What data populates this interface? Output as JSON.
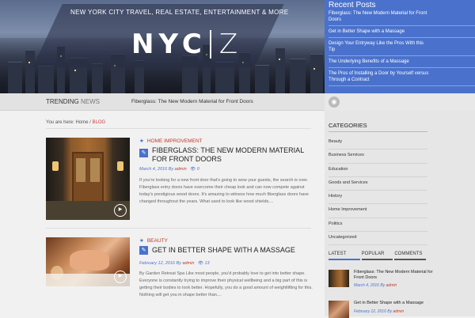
{
  "header": {
    "tagline": "NEW YORK CITY TRAVEL, REAL ESTATE, ENTERTAINMENT & MORE",
    "logo_left": "NYC",
    "logo_right": "Z"
  },
  "recent_posts": {
    "title": "Recent Posts",
    "items": [
      "Fiberglass: The New Modern Material for Front Doors",
      "Get in Better Shape with a Massage",
      "Design Your Entryway Like the Pros With this Tip",
      "The Underlying Benefits of a Massage",
      "The Pros of Installing a Door by Yourself versus Through a Contract"
    ]
  },
  "trending": {
    "label_bold": "TRENDING",
    "label_light": "NEWS",
    "ticker": "Fiberglass: The New Modern Material for Front Doors",
    "rss_icon": "rss-icon"
  },
  "breadcrumb": {
    "prefix": "You are here: Home /",
    "current": "BLOG"
  },
  "posts": [
    {
      "category": "HOME IMPROVEMENT",
      "title": "FIBERGLASS: THE NEW MODERN MATERIAL FOR FRONT DOORS",
      "date": "March 4, 2016",
      "by": "By",
      "author": "admin",
      "comments": "0",
      "excerpt": "If you're looking for a new front door that's going to wow your guests, the search is over. Fiberglass entry doors have overcome their cheap look and can now compete against today's prestigious wood doors. It's amazing to witness how much fiberglass doors have changed throughout the years. What used to look like wood shields...."
    },
    {
      "category": "BEAUTY",
      "title": "GET IN BETTER SHAPE WITH A MASSAGE",
      "date": "February 12, 2016",
      "by": "By",
      "author": "admin",
      "comments": "13",
      "excerpt": "By Garden Retreat Spa Like most people, you'd probably love to get into better shape. Everyone is constantly trying to improve their physical wellbeing and a big part of this is getting their bodies to look better. Hopefully, you do a good amount of weightlifting for this. Nothing will get you in shape better than...."
    }
  ],
  "sidebar": {
    "categories_title": "CATEGORIES",
    "categories": [
      "Beauty",
      "Business Services",
      "Education",
      "Goods and Services",
      "History",
      "Home Improvement",
      "Politics",
      "Uncategorized"
    ],
    "tabs": [
      "LATEST",
      "POPULAR",
      "COMMENTS"
    ],
    "latest": [
      {
        "title": "Fiberglass: The New Modern Material for Front Doors",
        "date": "March 4, 2016",
        "by": "By",
        "author": "admin"
      },
      {
        "title": "Get in Better Shape with a Massage",
        "date": "February 12, 2016",
        "by": "By",
        "author": "admin"
      }
    ]
  },
  "colors": {
    "accent_blue": "#4a72cc",
    "accent_red": "#c0392b"
  }
}
